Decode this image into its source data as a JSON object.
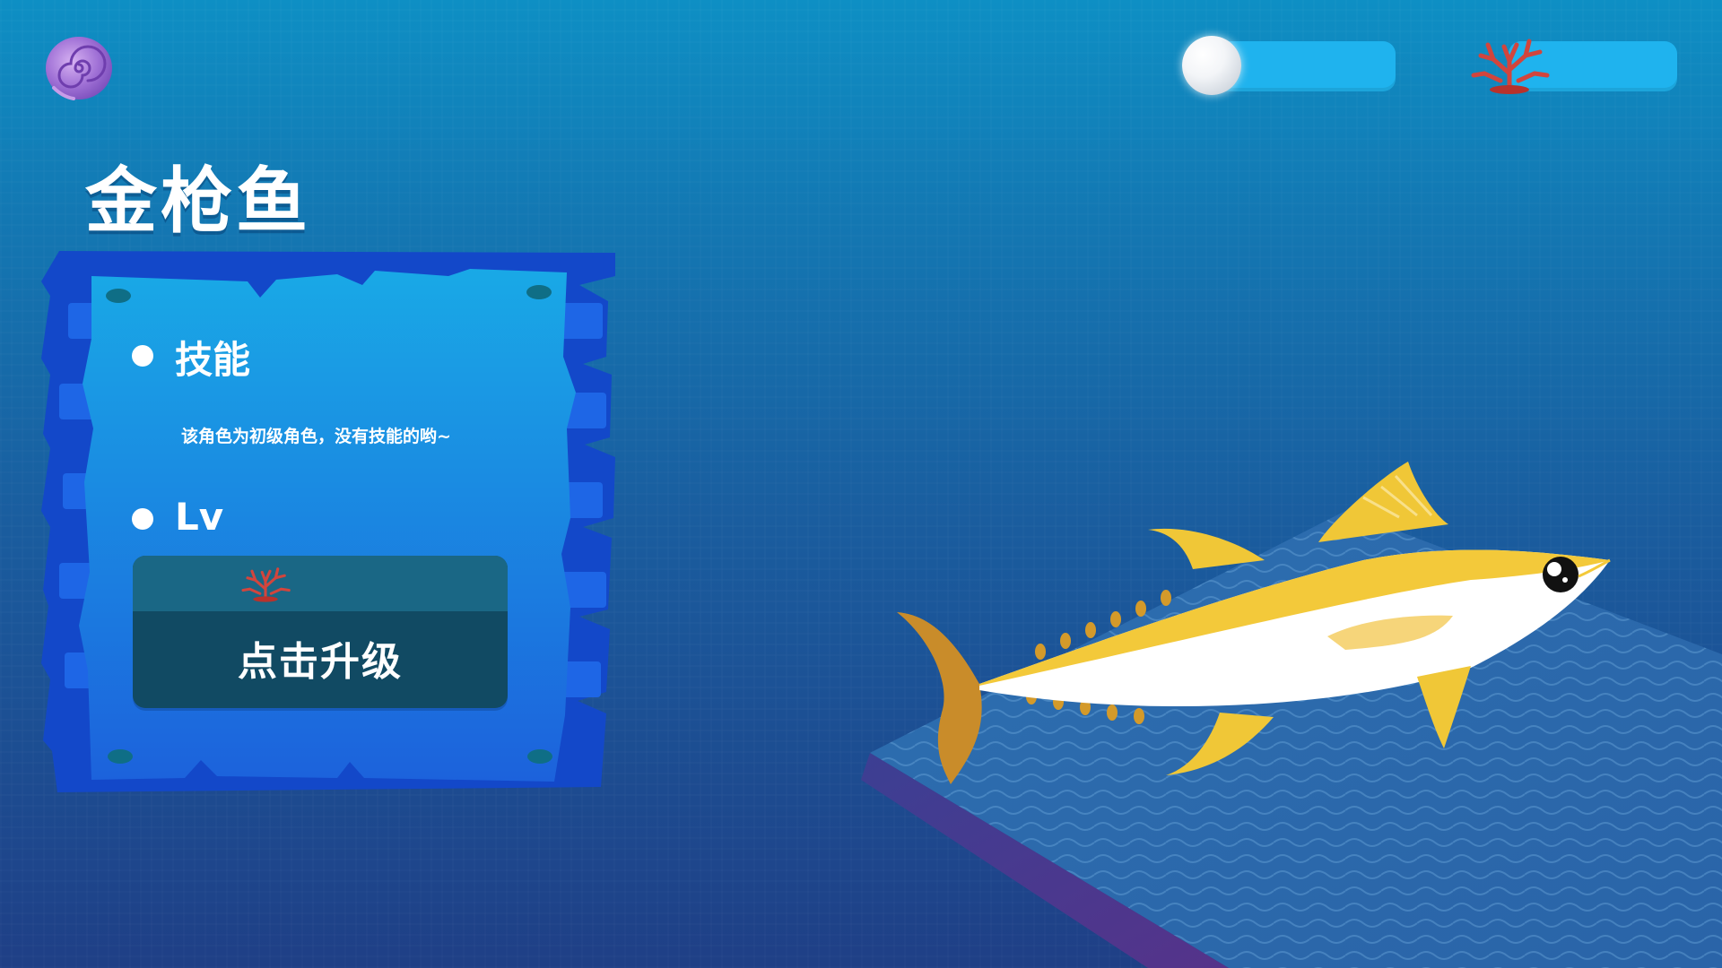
{
  "header": {
    "menu_icon": "purple-shell-icon",
    "pearl_icon": "pearl-icon",
    "pearl_value": "",
    "coral_icon": "coral-icon",
    "coral_value": ""
  },
  "fish": {
    "name": "金枪鱼",
    "image": "tuna-fish-illustration"
  },
  "info_panel": {
    "skill_label": "技能",
    "skill_description": "该角色为初级角色，没有技能的哟~",
    "level_label": "Lv"
  },
  "upgrade_button": {
    "cost_icon": "coral-icon",
    "cost_value": "",
    "label": "点击升级"
  },
  "colors": {
    "bg_top": "#0e8fc4",
    "bg_bottom": "#1f3f86",
    "board_blue": "#1a8fe0",
    "board_edge": "#1348c9",
    "button_dark": "#114a63",
    "button_top": "#1a6785",
    "resource_bar": "#1fb3ee",
    "fish_yellow": "#f3c93a",
    "fish_tail": "#c98c2a"
  }
}
